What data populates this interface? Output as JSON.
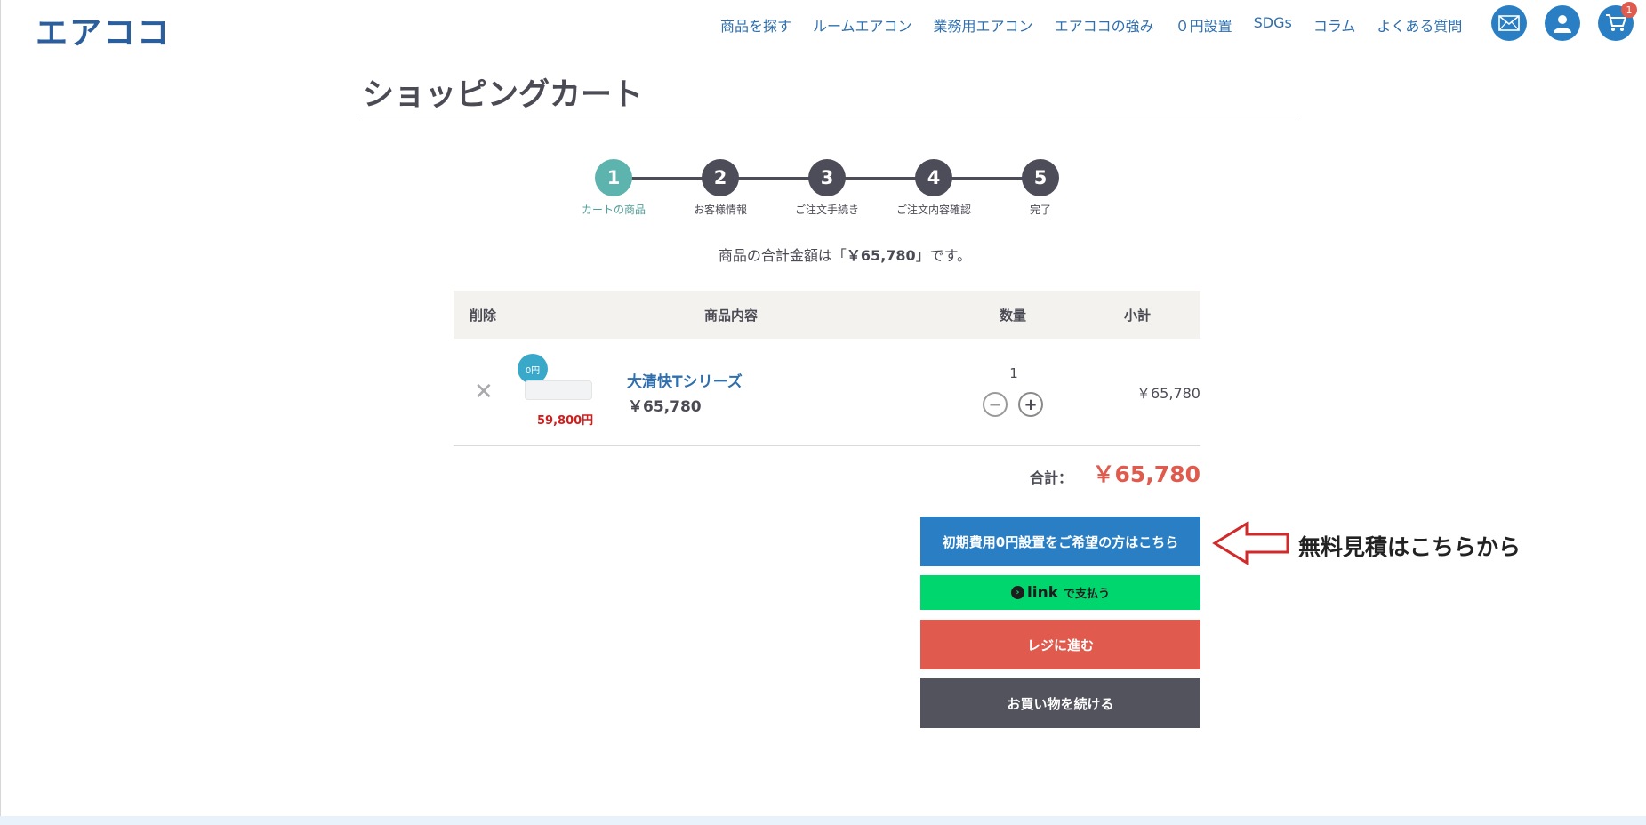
{
  "header": {
    "logo": "エアココ",
    "nav": [
      "商品を探す",
      "ルームエアコン",
      "業務用エアコン",
      "エアココの強み",
      "０円設置",
      "SDGs",
      "コラム",
      "よくある質問"
    ],
    "icons": {
      "mail": "mail-icon",
      "account": "user-icon",
      "cart": "cart-icon"
    },
    "cart_count": "1"
  },
  "page": {
    "title": "ショッピングカート"
  },
  "steps": [
    {
      "num": "1",
      "label": "カートの商品"
    },
    {
      "num": "2",
      "label": "お客様情報"
    },
    {
      "num": "3",
      "label": "ご注文手続き"
    },
    {
      "num": "4",
      "label": "ご注文内容確認"
    },
    {
      "num": "5",
      "label": "完了"
    }
  ],
  "summary": {
    "prefix": "商品の合計金額は「",
    "amount": "￥65,780",
    "suffix": "」です。"
  },
  "table": {
    "headers": {
      "remove": "削除",
      "content": "商品内容",
      "qty": "数量",
      "subtotal": "小計"
    },
    "item": {
      "remove_glyph": "✕",
      "thumb_badge": "0円",
      "thumb_price": "59,800円",
      "name": "大清快Tシリーズ",
      "price": "￥65,780",
      "qty": "1",
      "subtotal": "￥65,780"
    }
  },
  "total": {
    "label": "合計：",
    "value": "￥65,780"
  },
  "buttons": {
    "zero_install": "初期費用0円設置をご希望の方はこちら",
    "link_brand": "link",
    "link_suffix": "で支払う",
    "checkout": "レジに進む",
    "continue": "お買い物を続ける"
  },
  "annotation": "無料見積はこちらから",
  "colors": {
    "brand": "#2a7fc4",
    "step_active": "#5db3ad",
    "total_red": "#e05b4d",
    "link_green": "#00d66e",
    "continue_gray": "#53535e"
  }
}
